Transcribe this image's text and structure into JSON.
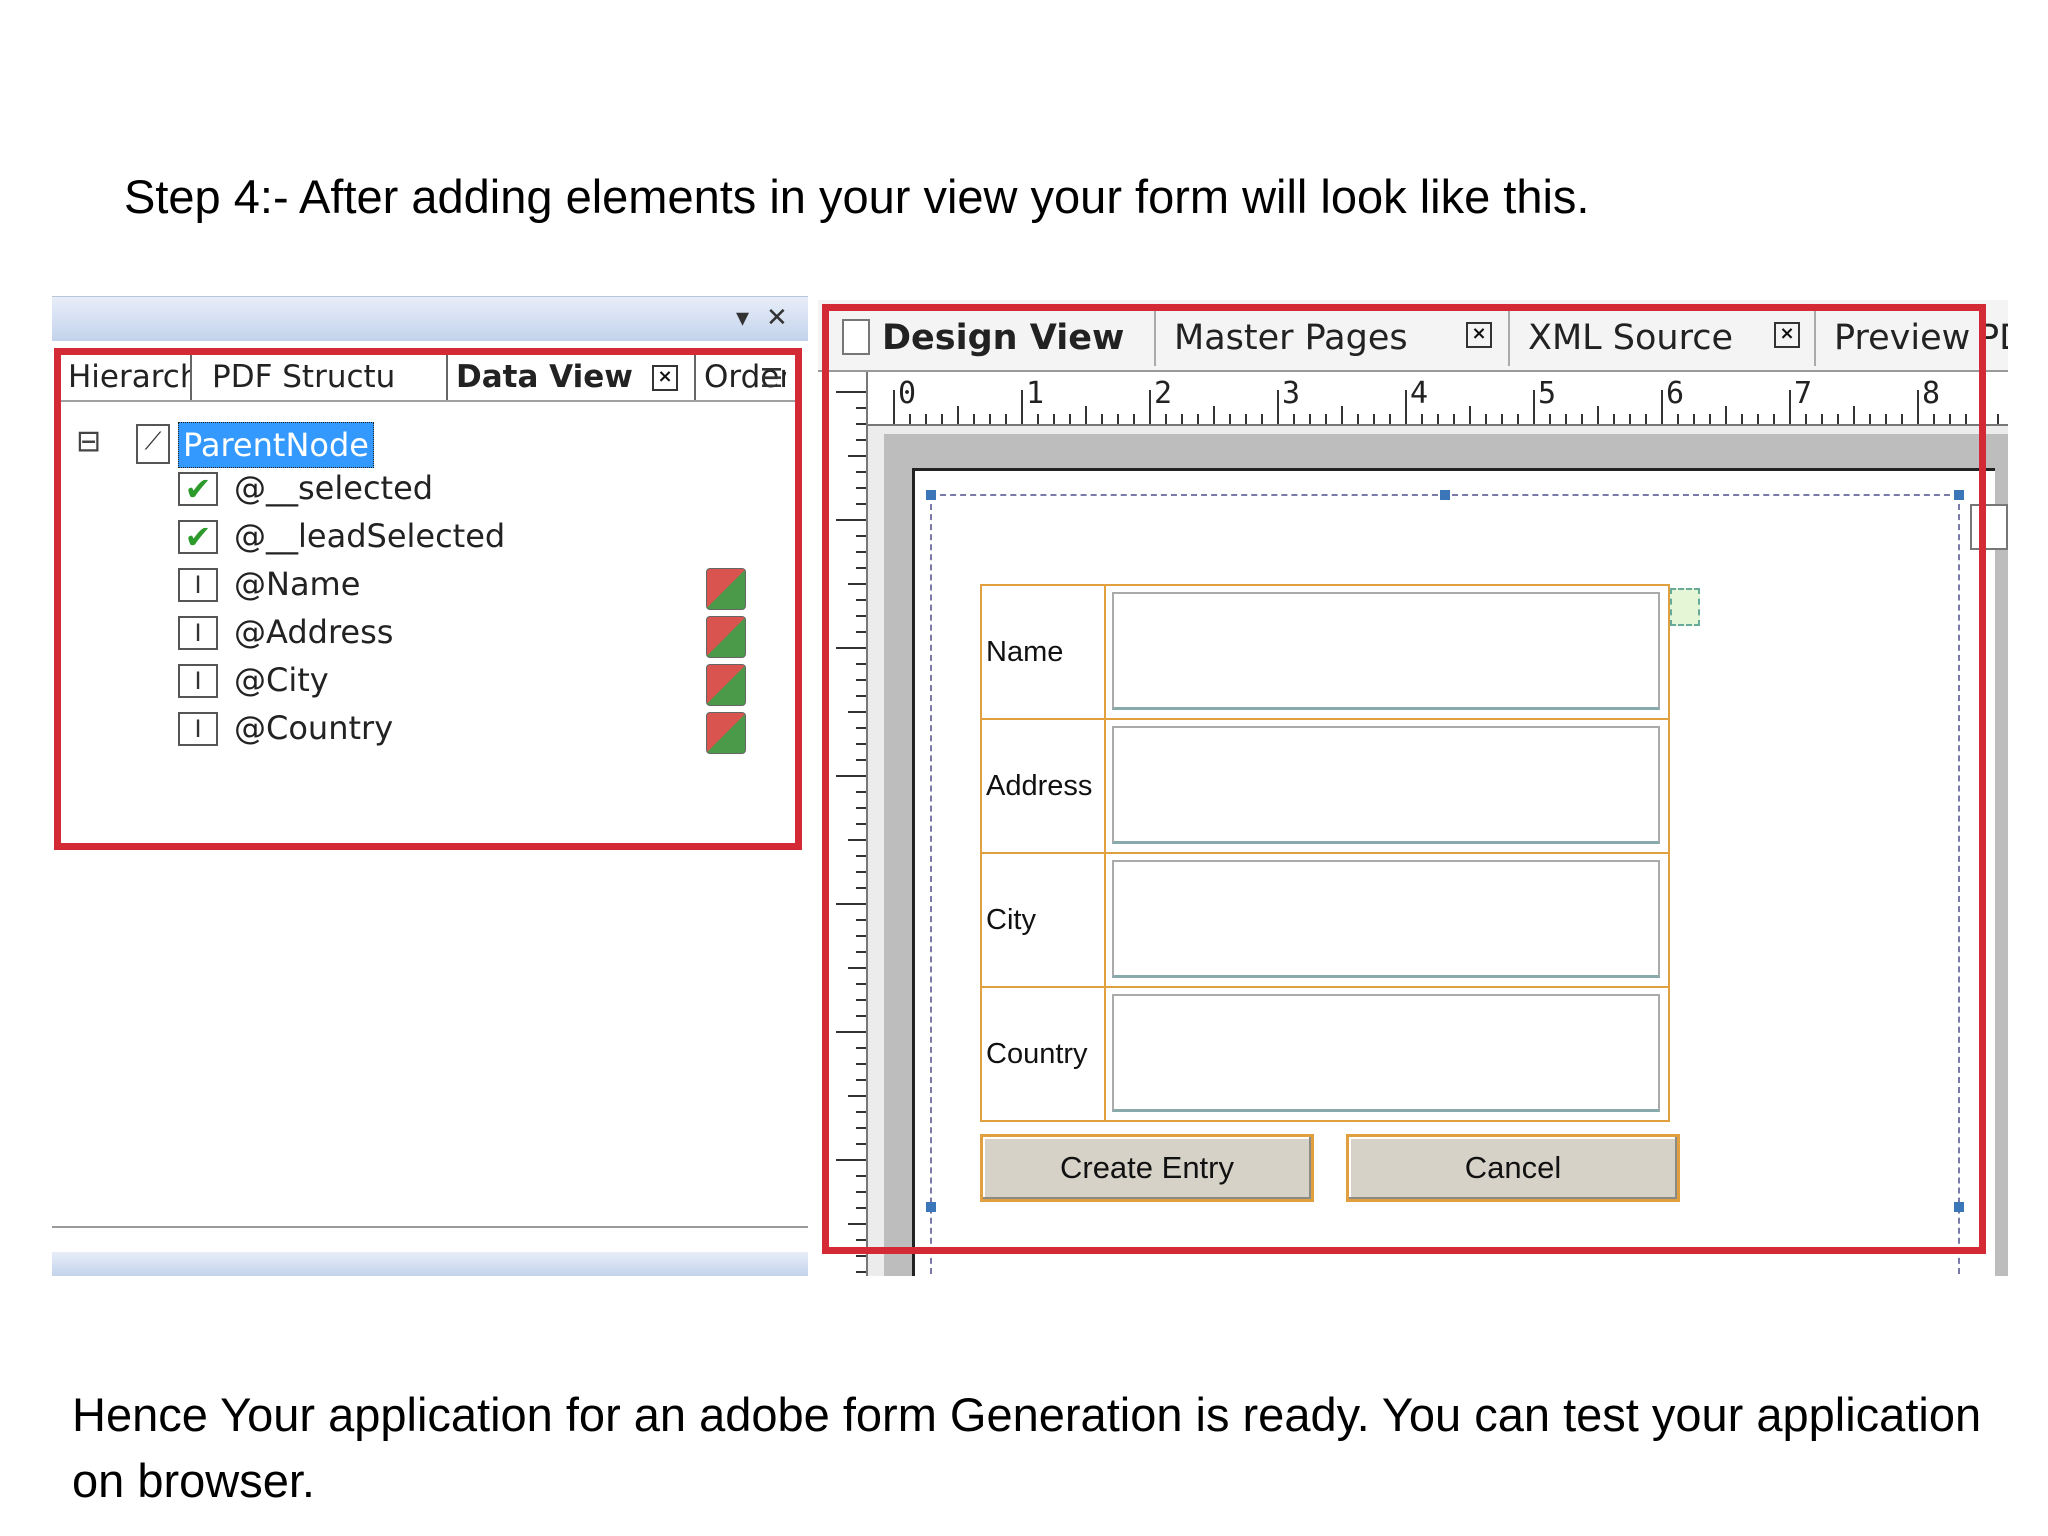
{
  "caption_top": "Step 4:- After adding elements in your view your form will look like this.",
  "caption_bottom": "Hence Your application for an adobe form Generation is ready. You can test your application on browser.",
  "left_panel": {
    "controls": {
      "pin": "▾",
      "close": "✕"
    },
    "tabs": [
      {
        "label": "Hierarch"
      },
      {
        "label": "PDF Structu"
      },
      {
        "label": "Data View"
      },
      {
        "label": "Order"
      }
    ],
    "tree": {
      "root": "ParentNode",
      "expander": "⊟",
      "items": [
        {
          "label": "@__selected",
          "icon": "check-icon"
        },
        {
          "label": "@__leadSelected",
          "icon": "check-icon"
        },
        {
          "label": "@Name",
          "icon": "text-field-icon"
        },
        {
          "label": "@Address",
          "icon": "text-field-icon"
        },
        {
          "label": "@City",
          "icon": "text-field-icon"
        },
        {
          "label": "@Country",
          "icon": "text-field-icon"
        }
      ]
    }
  },
  "right_panel": {
    "tabs": [
      {
        "label": "Design View"
      },
      {
        "label": "Master Pages"
      },
      {
        "label": "XML Source"
      },
      {
        "label": "Preview"
      },
      {
        "label": "PD"
      }
    ],
    "ruler_marks": [
      "0",
      "1",
      "2",
      "3",
      "4",
      "5",
      "6",
      "7",
      "8"
    ],
    "form": {
      "fields": [
        {
          "label": "Name"
        },
        {
          "label": "Address"
        },
        {
          "label": "City"
        },
        {
          "label": "Country"
        }
      ],
      "buttons": {
        "create": "Create Entry",
        "cancel": "Cancel"
      }
    }
  },
  "colors": {
    "highlight_frame": "#d32a35",
    "field_border": "#e0a040",
    "selection": "#3399ff"
  }
}
